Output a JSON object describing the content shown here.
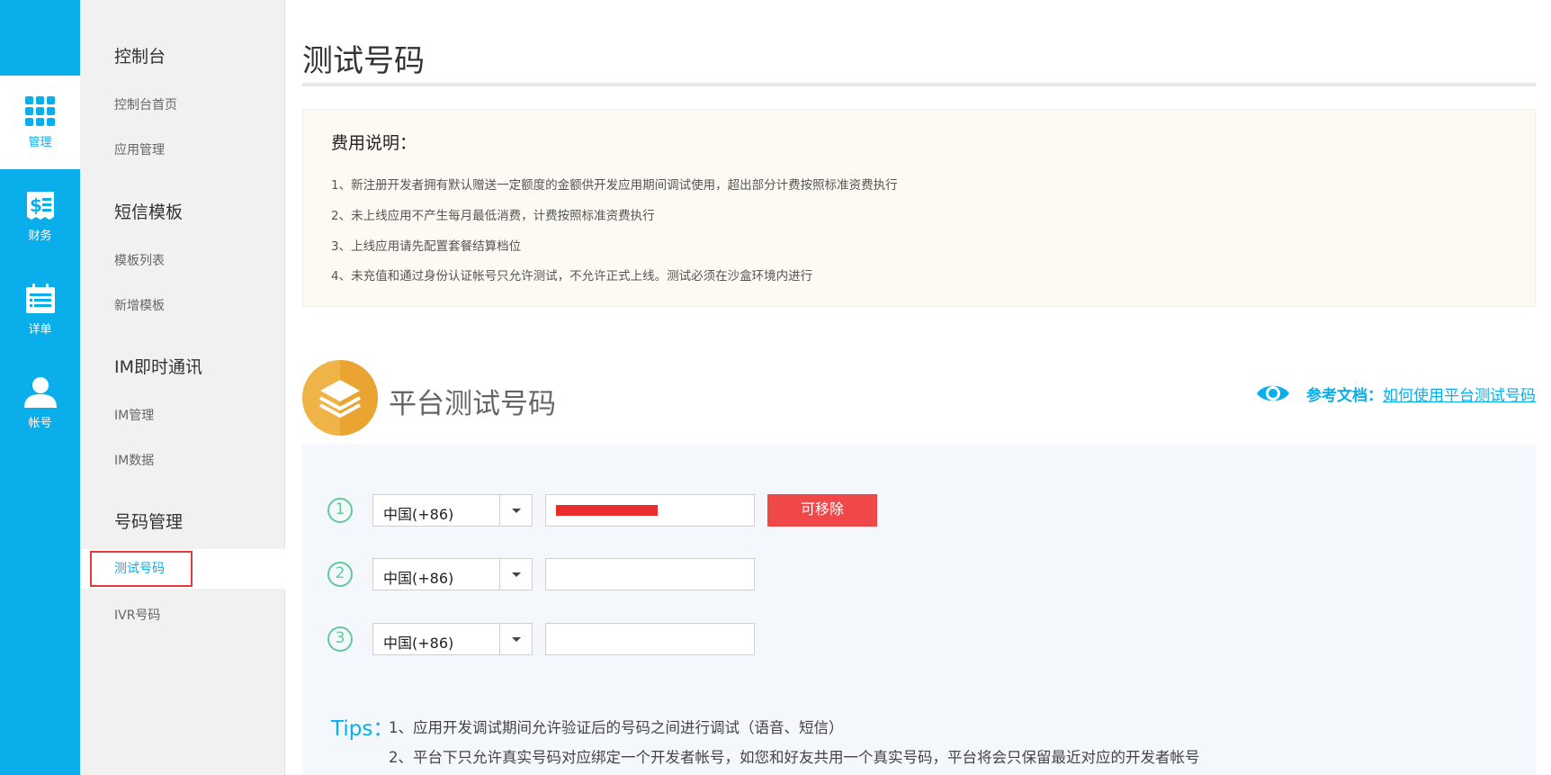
{
  "rail": {
    "items": [
      {
        "label": "管理",
        "icon": "grid-icon"
      },
      {
        "label": "财务",
        "icon": "finance-icon"
      },
      {
        "label": "详单",
        "icon": "calendar-list-icon"
      },
      {
        "label": "帐号",
        "icon": "user-icon"
      }
    ]
  },
  "subnav": {
    "groups": [
      {
        "title": "控制台",
        "links": [
          "控制台首页",
          "应用管理"
        ]
      },
      {
        "title": "短信模板",
        "links": [
          "模板列表",
          "新增模板"
        ]
      },
      {
        "title": "IM即时通讯",
        "links": [
          "IM管理",
          "IM数据"
        ]
      },
      {
        "title": "号码管理",
        "links": [
          "测试号码",
          "IVR号码"
        ]
      }
    ]
  },
  "page": {
    "title": "测试号码"
  },
  "fee": {
    "title": "费用说明：",
    "lines": [
      "1、新注册开发者拥有默认赠送一定额度的金额供开发应用期间调试使用，超出部分计费按照标准资费执行",
      "2、未上线应用不产生每月最低消费，计费按照标准资费执行",
      "3、上线应用请先配置套餐结算档位",
      "4、未充值和通过身份认证帐号只允许测试，不允许正式上线。测试必须在沙盒环境内进行"
    ]
  },
  "section": {
    "title": "平台测试号码",
    "ref_label": "参考文档：",
    "ref_link": "如何使用平台测试号码"
  },
  "rows": [
    {
      "num": "1",
      "country": "中国(+86)",
      "phone": "",
      "redacted": true,
      "action": "可移除"
    },
    {
      "num": "2",
      "country": "中国(+86)",
      "phone": ""
    },
    {
      "num": "3",
      "country": "中国(+86)",
      "phone": ""
    }
  ],
  "tips": {
    "label": "Tips：",
    "lines": [
      "1、应用开发调试期间允许验证后的号码之间进行调试（语音、短信）",
      "2、平台下只允许真实号码对应绑定一个开发者帐号，如您和好友共用一个真实号码，平台将会只保留最近对应的开发者帐号"
    ]
  },
  "colors": {
    "accent": "#0aaeea",
    "danger": "#f04848",
    "step": "#62c99a",
    "section_icon": "#f0b347"
  }
}
